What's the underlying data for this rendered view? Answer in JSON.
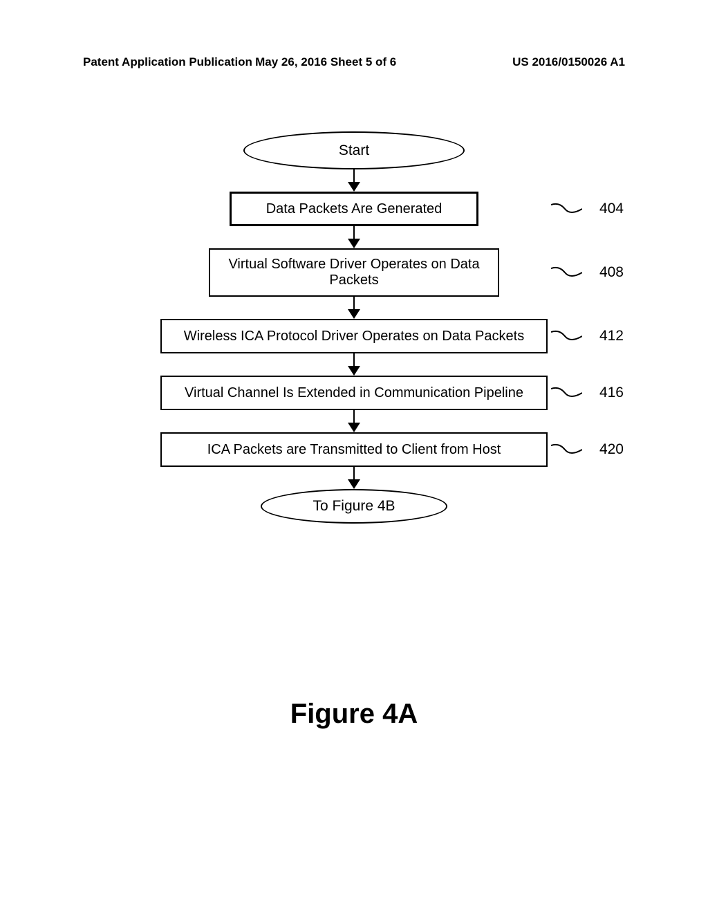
{
  "header": {
    "left": "Patent Application Publication",
    "center": "May 26, 2016  Sheet 5 of 6",
    "right": "US 2016/0150026 A1"
  },
  "flowchart": {
    "start": "Start",
    "steps": [
      {
        "text": "Data Packets Are Generated",
        "ref": "404"
      },
      {
        "text": "Virtual Software Driver Operates on Data Packets",
        "ref": "408"
      },
      {
        "text": "Wireless ICA Protocol Driver Operates on Data Packets",
        "ref": "412"
      },
      {
        "text": "Virtual Channel Is Extended in Communication Pipeline",
        "ref": "416"
      },
      {
        "text": "ICA Packets are Transmitted to Client from Host",
        "ref": "420"
      }
    ],
    "end": "To Figure 4B"
  },
  "figure_label": "Figure 4A"
}
